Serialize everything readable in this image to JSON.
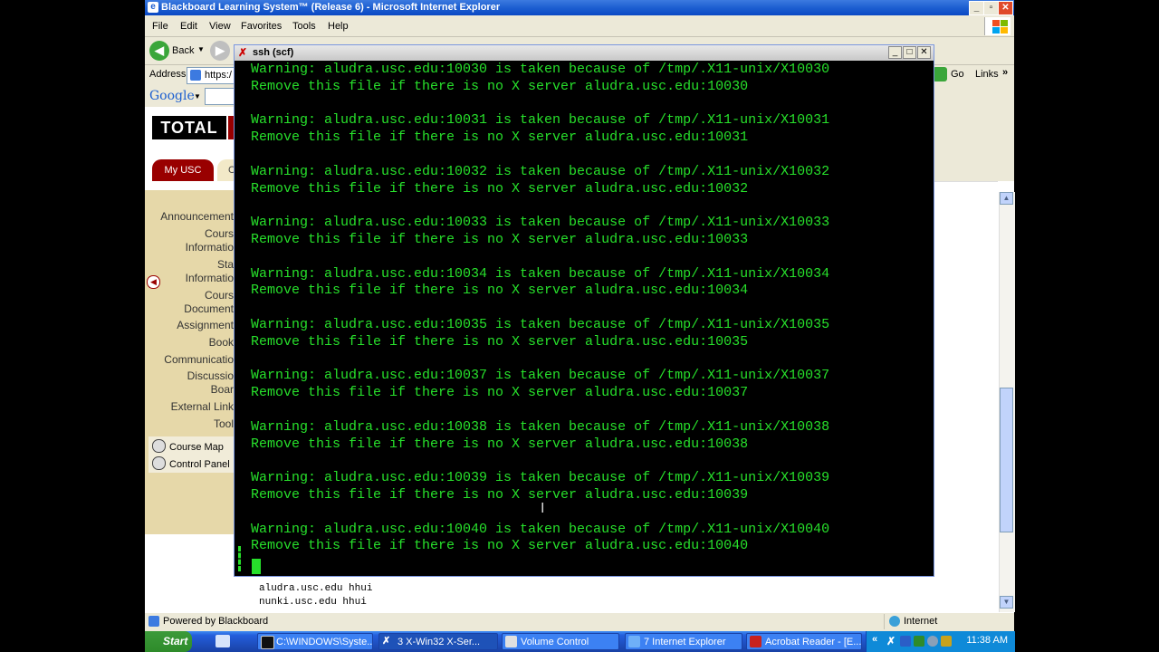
{
  "ie": {
    "title": "Blackboard Learning System™ (Release 6) - Microsoft Internet Explorer",
    "menu": [
      "File",
      "Edit",
      "View",
      "Favorites",
      "Tools",
      "Help"
    ],
    "back_label": "Back",
    "address_label": "Address",
    "address_value": "https:/",
    "go_label": "Go",
    "links_label": "Links",
    "google_label": "Google",
    "status_text": "Powered by Blackboard",
    "zone_text": "Internet"
  },
  "page": {
    "logo_text": "TOTAL",
    "tab_myusc": "My USC",
    "tab_other": "C",
    "sidebar": [
      "Announcement",
      "Cours\nInformatio",
      "Sta\nInformatio",
      "Cours\nDocument",
      "Assignment",
      "Book",
      "Communicatio",
      "Discussio\nBoar",
      "External Link",
      "Tool"
    ],
    "tools": [
      "Course Map",
      "Control Panel"
    ],
    "below_lines": [
      "aludra.usc.edu hhui",
      "nunki.usc.edu hhui"
    ]
  },
  "ssh": {
    "title": "ssh (scf)",
    "lines": [
      "Warning: aludra.usc.edu:10030 is taken because of /tmp/.X11-unix/X10030",
      "Remove this file if there is no X server aludra.usc.edu:10030",
      "",
      "Warning: aludra.usc.edu:10031 is taken because of /tmp/.X11-unix/X10031",
      "Remove this file if there is no X server aludra.usc.edu:10031",
      "",
      "Warning: aludra.usc.edu:10032 is taken because of /tmp/.X11-unix/X10032",
      "Remove this file if there is no X server aludra.usc.edu:10032",
      "",
      "Warning: aludra.usc.edu:10033 is taken because of /tmp/.X11-unix/X10033",
      "Remove this file if there is no X server aludra.usc.edu:10033",
      "",
      "Warning: aludra.usc.edu:10034 is taken because of /tmp/.X11-unix/X10034",
      "Remove this file if there is no X server aludra.usc.edu:10034",
      "",
      "Warning: aludra.usc.edu:10035 is taken because of /tmp/.X11-unix/X10035",
      "Remove this file if there is no X server aludra.usc.edu:10035",
      "",
      "Warning: aludra.usc.edu:10037 is taken because of /tmp/.X11-unix/X10037",
      "Remove this file if there is no X server aludra.usc.edu:10037",
      "",
      "Warning: aludra.usc.edu:10038 is taken because of /tmp/.X11-unix/X10038",
      "Remove this file if there is no X server aludra.usc.edu:10038",
      "",
      "Warning: aludra.usc.edu:10039 is taken because of /tmp/.X11-unix/X10039",
      "Remove this file if there is no X server aludra.usc.edu:10039",
      "",
      "Warning: aludra.usc.edu:10040 is taken because of /tmp/.X11-unix/X10040",
      "Remove this file if there is no X server aludra.usc.edu:10040"
    ]
  },
  "taskbar": {
    "start": "Start",
    "buttons": [
      "C:\\WINDOWS\\Syste...",
      "3 X-Win32 X-Ser...",
      "Volume Control",
      "7 Internet Explorer",
      "Acrobat Reader - [E..."
    ],
    "clock": "11:38 AM"
  },
  "colors": {
    "terminal_text": "#27e02b",
    "usc_red": "#990000",
    "xp_blue": "#245edb"
  }
}
